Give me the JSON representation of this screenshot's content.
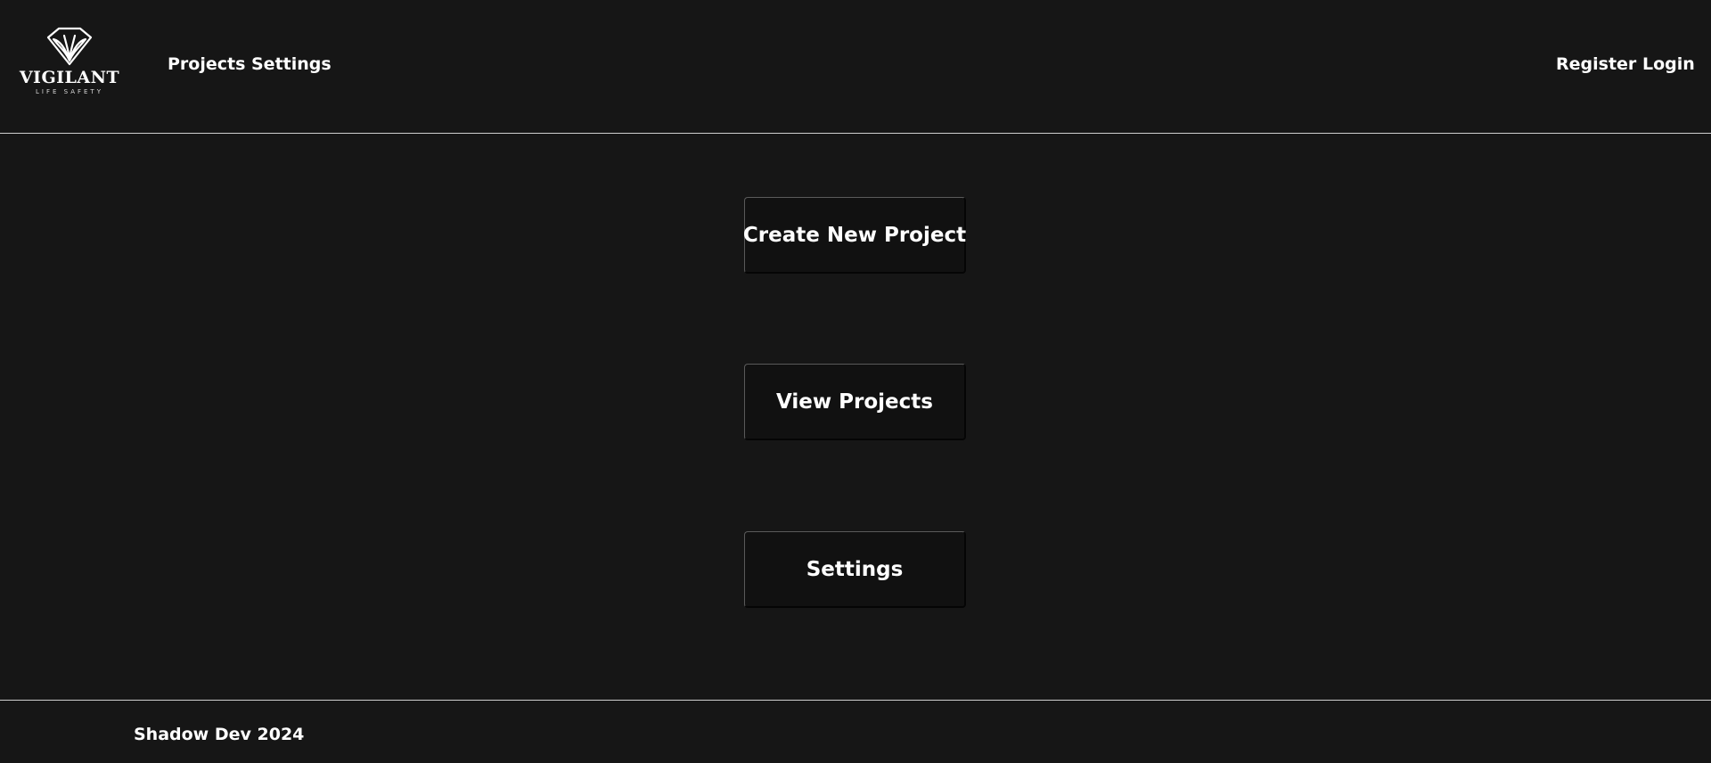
{
  "brand": {
    "name": "VIGILANT",
    "tagline": "LIFE SAFETY",
    "icon": "shield-leaf-icon"
  },
  "nav": {
    "left": [
      {
        "label": "Projects"
      },
      {
        "label": "Settings"
      }
    ],
    "right": [
      {
        "label": "Register"
      },
      {
        "label": "Login"
      }
    ]
  },
  "actions": [
    {
      "label": "Create New Project"
    },
    {
      "label": "View Projects"
    },
    {
      "label": "Settings"
    }
  ],
  "footer": {
    "text": "Shadow Dev 2024"
  },
  "colors": {
    "background": "#161616",
    "button_background": "#111111",
    "text": "#ffffff",
    "divider": "#cfcfcf"
  }
}
